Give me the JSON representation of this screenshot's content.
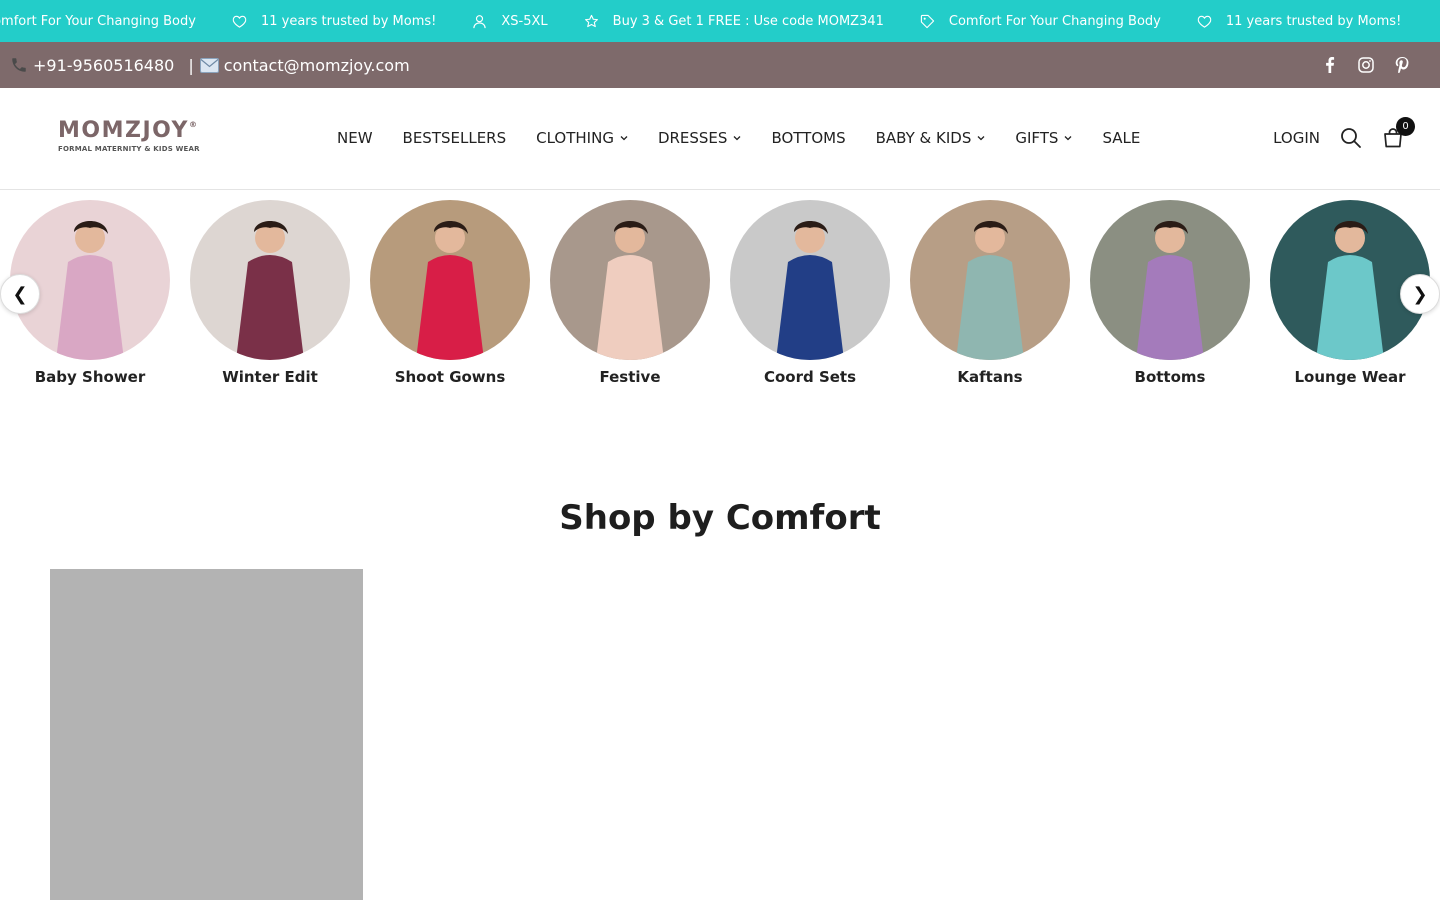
{
  "announcement": {
    "items": [
      {
        "icon": "heart-icon",
        "text": "Comfort For Your Changing Body"
      },
      {
        "icon": "heart-icon",
        "text": "11 years trusted by Moms!"
      },
      {
        "icon": "user-icon",
        "text": "XS-5XL"
      },
      {
        "icon": "star-icon",
        "text": "Buy 3 & Get 1 FREE : Use code MOMZ341"
      },
      {
        "icon": "tag-icon",
        "text": "Comfort For Your Changing Body"
      },
      {
        "icon": "heart-icon",
        "text": "11 years trusted by Moms!"
      }
    ],
    "background": "#23cdc9"
  },
  "contact": {
    "phone": "+91-9560516480",
    "separator": "|",
    "email": "contact@momzjoy.com",
    "background": "#7e6a6b"
  },
  "social": [
    "facebook-icon",
    "instagram-icon",
    "pinterest-icon"
  ],
  "logo": {
    "name": "MOMZJOY",
    "mark": "®",
    "tagline": "FORMAL MATERNITY & KIDS WEAR"
  },
  "nav": {
    "items": [
      {
        "label": "NEW",
        "dropdown": false
      },
      {
        "label": "BESTSELLERS",
        "dropdown": false
      },
      {
        "label": "CLOTHING",
        "dropdown": true
      },
      {
        "label": "DRESSES",
        "dropdown": true
      },
      {
        "label": "BOTTOMS",
        "dropdown": false
      },
      {
        "label": "BABY & KIDS",
        "dropdown": true
      },
      {
        "label": "GIFTS",
        "dropdown": true
      },
      {
        "label": "SALE",
        "dropdown": false
      }
    ]
  },
  "header": {
    "login_label": "LOGIN",
    "cart_count": "0"
  },
  "categories": {
    "prev_label": "❮",
    "next_label": "❯",
    "items": [
      {
        "label": "Baby Shower",
        "bg": "#e9d3d6",
        "dress": "#d9a7c4"
      },
      {
        "label": "Winter Edit",
        "bg": "#ddd6d2",
        "dress": "#7a3048"
      },
      {
        "label": "Shoot Gowns",
        "bg": "#b79b7c",
        "dress": "#d81e47"
      },
      {
        "label": "Festive",
        "bg": "#a8988c",
        "dress": "#efcdbf"
      },
      {
        "label": "Coord Sets",
        "bg": "#c9c9c9",
        "dress": "#223e86"
      },
      {
        "label": "Kaftans",
        "bg": "#b79e86",
        "dress": "#8fb6b0"
      },
      {
        "label": "Bottoms",
        "bg": "#8b8f82",
        "dress": "#a47bbb"
      },
      {
        "label": "Lounge Wear",
        "bg": "#2f5a5c",
        "dress": "#6cc8c9"
      }
    ]
  },
  "section": {
    "title": "Shop by Comfort"
  }
}
